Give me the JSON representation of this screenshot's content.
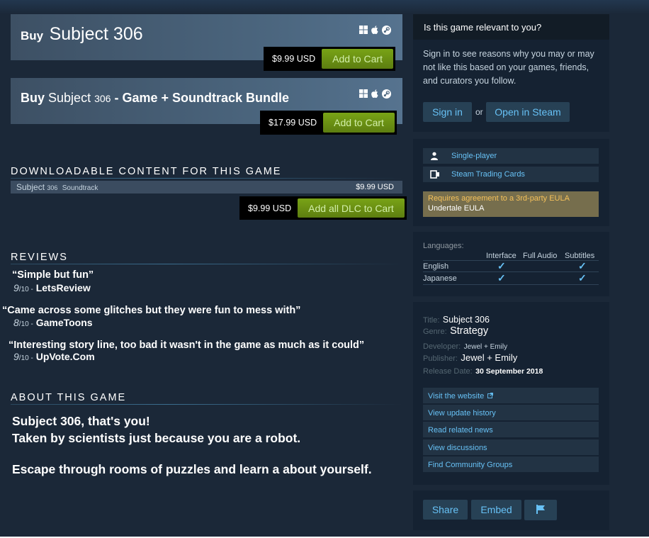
{
  "purchase": [
    {
      "buy_word": "Buy",
      "title": "Subject 306",
      "price": "$9.99 USD",
      "cta": "Add to Cart"
    },
    {
      "buy_word": "Buy",
      "title_a": "Subject",
      "title_num": "306",
      "title_b": "- Game + Soundtrack Bundle",
      "price": "$17.99 USD",
      "cta": "Add to Cart"
    }
  ],
  "platform_icons": [
    "windows-icon",
    "apple-icon",
    "steam-icon"
  ],
  "dlc": {
    "heading": "DOWNLOADABLE CONTENT FOR THIS GAME",
    "item_name": "Subject",
    "item_num": "306",
    "item_tag": "Soundtrack",
    "item_price": "$9.99 USD",
    "total_price": "$9.99 USD",
    "cta": "Add all DLC to Cart"
  },
  "reviews": {
    "heading": "REVIEWS",
    "items": [
      {
        "quote": "“Simple but fun”",
        "score": "9",
        "out_of": "/10 -",
        "source": "LetsReview"
      },
      {
        "quote": "“Came across some glitches but they were fun to mess with”",
        "score": "8",
        "out_of": "/10 -",
        "source": "GameToons"
      },
      {
        "quote": "“Interesting story line, too bad it wasn't in the game as much as it could”",
        "score": "9",
        "out_of": "/10 -",
        "source": "UpVote.Com"
      }
    ]
  },
  "about": {
    "heading": "ABOUT THIS GAME",
    "line1": "Subject 306, that's you!",
    "line2": "Taken by scientists just because you are a robot.",
    "line3": "Escape through rooms of puzzles and learn a about yourself."
  },
  "relevance": {
    "heading": "Is this game relevant to you?",
    "text": "Sign in to see reasons why you may or may not like this based on your games, friends, and curators you follow.",
    "sign_in": "Sign in",
    "or": "or",
    "open_steam": "Open in Steam"
  },
  "features": {
    "items": [
      {
        "icon": "single-player-icon",
        "label": "Single-player"
      },
      {
        "icon": "trading-cards-icon",
        "label": "Steam Trading Cards"
      }
    ],
    "eula_notice": "Requires agreement to a 3rd-party EULA",
    "eula_name": "Undertale EULA"
  },
  "languages": {
    "label": "Languages:",
    "columns": [
      "Interface",
      "Full Audio",
      "Subtitles"
    ],
    "rows": [
      {
        "name": "English",
        "checks": [
          true,
          false,
          true
        ]
      },
      {
        "name": "Japanese",
        "checks": [
          true,
          false,
          true
        ]
      }
    ],
    "check_glyph": "✓"
  },
  "details": {
    "title_label": "Title:",
    "title": "Subject 306",
    "genre_label": "Genre:",
    "genre": "Strategy",
    "developer_label": "Developer:",
    "developer": "Jewel + Emily",
    "publisher_label": "Publisher:",
    "publisher": "Jewel + Emily",
    "release_label": "Release Date:",
    "release_date": "30 September 2018"
  },
  "links": [
    "Visit the website",
    "View update history",
    "Read related news",
    "View discussions",
    "Find Community Groups"
  ],
  "share": {
    "share": "Share",
    "embed": "Embed",
    "flag_icon": "flag-icon"
  }
}
